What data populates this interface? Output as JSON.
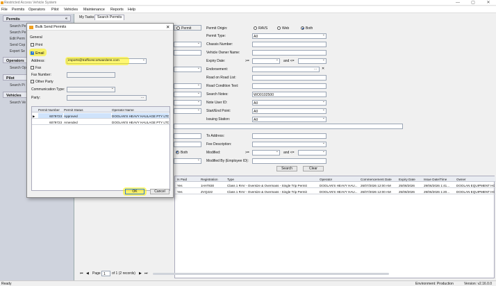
{
  "window": {
    "title": "Restricted Access Vehicle System",
    "min": "—",
    "max": "▢",
    "close": "✕"
  },
  "menu": [
    "File",
    "Permits",
    "Operators",
    "Pilot",
    "Vehicles",
    "Maintenance",
    "Reports",
    "Help"
  ],
  "sidebar": {
    "permits": {
      "label": "Permits",
      "badge": "«",
      "items": [
        "Search Pe",
        "Search Pe",
        "Edit Perm",
        "Send Cop",
        "Export Se"
      ]
    },
    "operators": {
      "label": "Operators",
      "items": [
        "Search Op"
      ]
    },
    "pilot": {
      "label": "Pilot",
      "items": [
        "Search Pi"
      ]
    },
    "vehicles": {
      "label": "Vehicles",
      "items": [
        "Search Ve"
      ]
    }
  },
  "tabs": [
    "My Tasks",
    "Search Permits"
  ],
  "form": {
    "permit_radio": "Permit",
    "permit_origin_label": "Permit Origin:",
    "origin_options": [
      "RAVS",
      "Web",
      "Both"
    ],
    "permit_type_label": "Permit Type:",
    "permit_type_value": "All",
    "chassis_label": "Chassis Number:",
    "vehicle_owner_label": "Vehicle Owner Name:",
    "expiry_label": "Expiry Date:",
    "gte": ">=",
    "and_lte": "and <=",
    "endorsement_label": "Endorsement:",
    "ellipsis": "...",
    "clear_x": "✕",
    "road_list_label": "Road on Road List:",
    "road_cond_label": "Road Condition Text:",
    "search_notes_label": "Search Notes:",
    "search_notes_value": "WO0102500",
    "note_user_label": "Note User ID:",
    "note_user_value": "All",
    "start_end_label": "Start/End Point:",
    "start_end_value": "All",
    "issuing_label": "Issuing Station:",
    "issuing_value": "All",
    "to_address_label": "To Address:",
    "fee_desc_label": "Fee Description:",
    "both_radio": "Both",
    "modified_label": "Modified:",
    "modified_by_label": "Modified By (Employee ID):",
    "search_button": "Search",
    "clear_button": "Clear"
  },
  "results": {
    "columns": [
      "Is Paid",
      "Registration",
      "Type",
      "Operator",
      "Commencement Date",
      "Expiry Date",
      "Issue Date/Time",
      "Owner"
    ],
    "rows": [
      [
        "Yes",
        "1HAT830",
        "Class 1 RAV - Oversize & Overmass - Single Trip Permit",
        "DOOLAN'S HEAVY HAU...",
        "26/07/2026 12:00 AM",
        "25/08/2026",
        "29/06/2026 1:41...",
        "DOOLAN EQUIPMENT HO"
      ],
      [
        "Yes",
        "ZVQ222",
        "Class 1 RAV - Oversize & Overmass - Single Trip Permit",
        "DOOLAN'S HEAVY HAU...",
        "26/07/2026 12:00 AM",
        "25/08/2026",
        "29/06/2026 1:20...",
        "DOOLAN EQUIPMENT HO"
      ]
    ]
  },
  "pager": {
    "page_label": "Page",
    "page": "1",
    "of": "of 1 (2 records)",
    "first": "⏮",
    "prev": "◀",
    "next": "▶",
    "last": "⏭"
  },
  "status": {
    "left": "Ready",
    "env": "Environment: Production",
    "version": "Version: v2.16.0.0"
  },
  "dialog": {
    "title": "Bulk Send Permits",
    "close": "✕",
    "general": "General",
    "print": "Print",
    "email": "Email",
    "address_label": "Address:",
    "address_value": "imports@trafficescortwardens.com",
    "fax": "Fax",
    "fax_number_label": "Fax Number:",
    "other_party": "Other Party",
    "comm_type_label": "Communication Type:",
    "party_label": "Party:",
    "party_btn": "...",
    "grid_columns": [
      "Permit Number",
      "Permit Status",
      "Operator Name"
    ],
    "grid_rows": [
      [
        "6079723",
        "Approved",
        "DOOLAN'S HEAVY HAULAGE PTY LTD"
      ],
      [
        "6079723",
        "Amended",
        "DOOLAN'S HEAVY HAULAGE PTY LTD"
      ]
    ],
    "row_marker": "▶",
    "ok_button": "OK",
    "cancel_button": "Cancel"
  },
  "colors": {
    "highlight": "#fff200",
    "selection": "#cfe3fb",
    "checkbox": "#2d7ad6"
  }
}
